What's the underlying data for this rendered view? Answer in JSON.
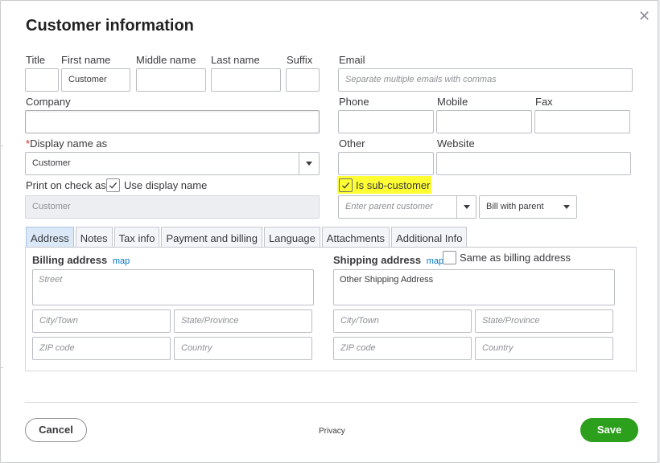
{
  "dialog": {
    "title": "Customer information"
  },
  "name": {
    "title_label": "Title",
    "first_label": "First name",
    "first_value": "Customer",
    "middle_label": "Middle name",
    "last_label": "Last name",
    "suffix_label": "Suffix"
  },
  "email": {
    "label": "Email",
    "placeholder": "Separate multiple emails with commas"
  },
  "company": {
    "label": "Company"
  },
  "contact": {
    "phone_label": "Phone",
    "mobile_label": "Mobile",
    "fax_label": "Fax",
    "other_label": "Other",
    "website_label": "Website"
  },
  "display_name": {
    "required_mark": "*",
    "label": "Display name as",
    "value": "Customer"
  },
  "print_check": {
    "label": "Print on check as",
    "use_display_label": "Use display name",
    "value": "Customer",
    "checked": true
  },
  "sub_customer": {
    "label": "Is sub-customer",
    "checked": true,
    "parent_placeholder": "Enter parent customer",
    "billing_option": "Bill with parent"
  },
  "tabs": [
    {
      "label": "Address"
    },
    {
      "label": "Notes"
    },
    {
      "label": "Tax info"
    },
    {
      "label": "Payment and billing"
    },
    {
      "label": "Language"
    },
    {
      "label": "Attachments"
    },
    {
      "label": "Additional Info"
    }
  ],
  "billing": {
    "label": "Billing address",
    "map": "map",
    "street_placeholder": "Street",
    "city_placeholder": "City/Town",
    "state_placeholder": "State/Province",
    "zip_placeholder": "ZIP code",
    "country_placeholder": "Country"
  },
  "shipping": {
    "label": "Shipping address",
    "map": "map",
    "same_label": "Same as billing address",
    "street_value": "Other Shipping Address",
    "city_placeholder": "City/Town",
    "state_placeholder": "State/Province",
    "zip_placeholder": "ZIP code",
    "country_placeholder": "Country"
  },
  "footer": {
    "cancel": "Cancel",
    "privacy": "Privacy",
    "save": "Save"
  },
  "colors": {
    "save_green": "#2ca01c",
    "highlight": "#ffff33",
    "link_blue": "#0077c5"
  }
}
